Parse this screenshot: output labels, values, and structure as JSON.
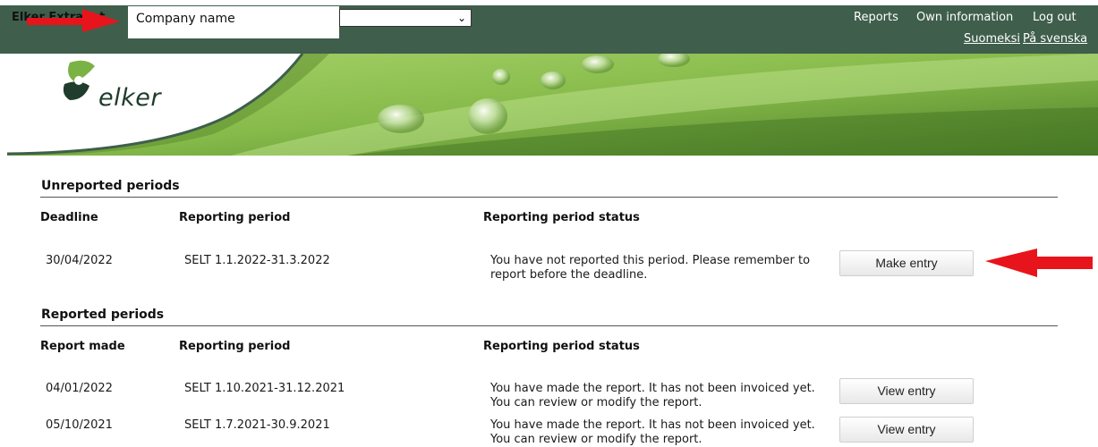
{
  "header": {
    "site_label": "Elker Extranet",
    "company_name": "Company name",
    "company_select_value": "",
    "logo_text": "elker",
    "nav": [
      "Reports",
      "Own information",
      "Log out"
    ],
    "languages": [
      "Suomeksi",
      "På svenska"
    ]
  },
  "unreported": {
    "title": "Unreported periods",
    "columns": [
      "Deadline",
      "Reporting period",
      "Reporting period status"
    ],
    "rows": [
      {
        "date": "30/04/2022",
        "period": "SELT 1.1.2022-31.3.2022",
        "status": "You have not reported this period. Please remember to report before the deadline.",
        "button": "Make entry"
      }
    ]
  },
  "reported": {
    "title": "Reported periods",
    "columns": [
      "Report made",
      "Reporting period",
      "Reporting period status"
    ],
    "rows": [
      {
        "date": "04/01/2022",
        "period": "SELT 1.10.2021-31.12.2021",
        "status": "You have made the report. It has not been invoiced yet. You can review or modify the report.",
        "button": "View entry"
      },
      {
        "date": "05/10/2021",
        "period": "SELT 1.7.2021-30.9.2021",
        "status": "You have made the report. It has not been invoiced yet. You can review or modify the report.",
        "button": "View entry"
      }
    ]
  },
  "colors": {
    "header_bg": "#3f5e4c",
    "annotation_arrow": "#e8141c"
  }
}
